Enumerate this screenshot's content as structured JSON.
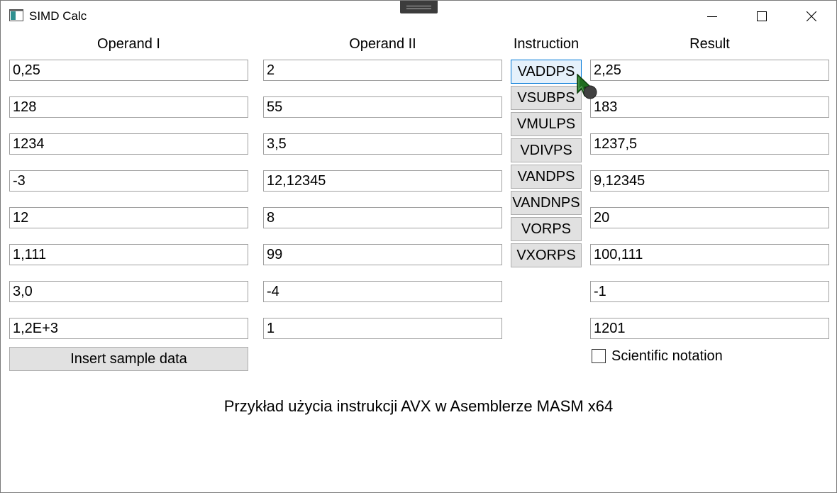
{
  "window": {
    "title": "SIMD Calc"
  },
  "headers": {
    "operand1": "Operand I",
    "operand2": "Operand II",
    "instruction": "Instruction",
    "result": "Result"
  },
  "operand1": [
    "0,25",
    "128",
    "1234",
    "-3",
    "12",
    "1,111",
    "3,0",
    "1,2E+3"
  ],
  "operand2": [
    "2",
    "55",
    "3,5",
    "12,12345",
    "8",
    "99",
    "-4",
    "1"
  ],
  "result": [
    "2,25",
    "183",
    "1237,5",
    "9,12345",
    "20",
    "100,111",
    "-1",
    "1201"
  ],
  "instructions": [
    "VADDPS",
    "VSUBPS",
    "VMULPS",
    "VDIVPS",
    "VANDPS",
    "VANDNPS",
    "VORPS",
    "VXORPS"
  ],
  "hovered_instruction": "VADDPS",
  "sample_button": "Insert sample data",
  "scientific_notation": {
    "label": "Scientific notation",
    "checked": false
  },
  "footer": "Przykład użycia instrukcji AVX w Asemblerze MASM x64",
  "icons": {
    "app": "app-window-icon",
    "minimize": "minimize-icon",
    "maximize": "maximize-icon",
    "close": "close-icon",
    "cursor": "busy-pointer-icon"
  }
}
